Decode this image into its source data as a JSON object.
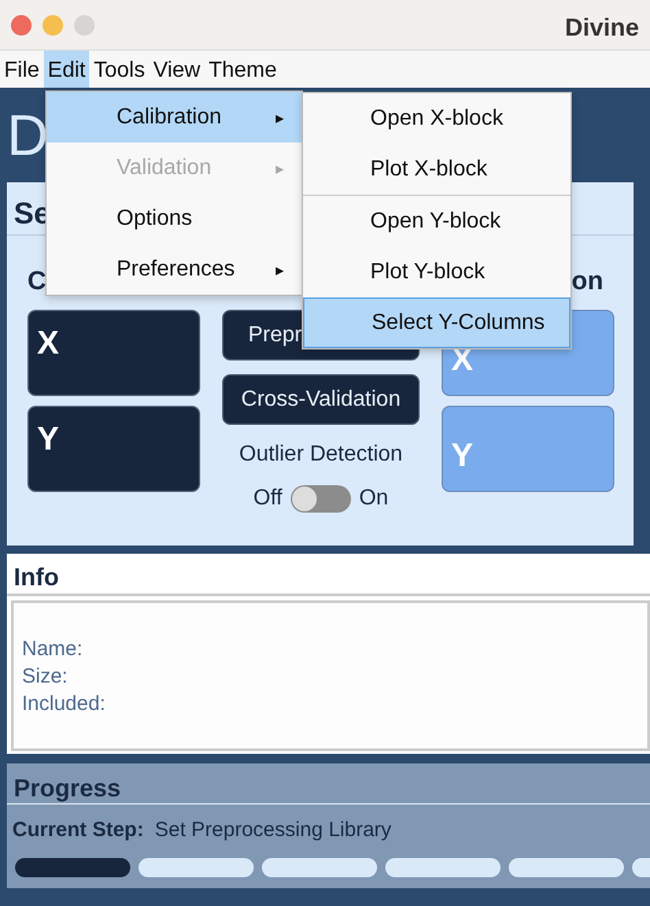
{
  "window": {
    "title": "Divine"
  },
  "menu_bar": [
    {
      "label": "File",
      "selected": false
    },
    {
      "label": "Edit",
      "selected": true
    },
    {
      "label": "Tools",
      "selected": false
    },
    {
      "label": "View",
      "selected": false
    },
    {
      "label": "Theme",
      "selected": false
    }
  ],
  "edit_menu": [
    {
      "label": "Calibration",
      "arrow": "▸",
      "selected": true,
      "disabled": false
    },
    {
      "label": "Validation",
      "arrow": "▸",
      "selected": false,
      "disabled": true
    },
    {
      "label": "Options",
      "selected": false,
      "disabled": false
    },
    {
      "label": "Preferences",
      "arrow": "▸",
      "selected": false,
      "disabled": false
    }
  ],
  "calibration_submenu": [
    {
      "label": "Open X-block",
      "selected": false,
      "separator_before": false
    },
    {
      "label": "Plot X-block",
      "selected": false,
      "separator_before": false
    },
    {
      "label": "Open Y-block",
      "selected": false,
      "separator_before": true
    },
    {
      "label": "Plot Y-block",
      "selected": false,
      "separator_before": false
    },
    {
      "label": "Select Y-Columns",
      "selected": true,
      "separator_before": false
    }
  ],
  "page_heading": "D",
  "setup_panel": {
    "title": "Se",
    "left_column": {
      "heading": "C",
      "blocks": [
        "X",
        "Y"
      ]
    },
    "middle_column": {
      "buttons": [
        "Prepr",
        "Cross-Validation"
      ],
      "outlier_detection": {
        "label": "Outlier Detection",
        "off_label": "Off",
        "on_label": "On",
        "on": false
      }
    },
    "right_column": {
      "heading": "on",
      "blocks": [
        "X",
        "Y"
      ]
    }
  },
  "info_panel": {
    "title": "Info",
    "fields": [
      "Name:",
      "Size:",
      "Included:"
    ]
  },
  "progress_panel": {
    "title": "Progress",
    "current_step_label": "Current Step:",
    "current_step": "Set Preprocessing Library",
    "steps": [
      {
        "complete": true
      },
      {
        "complete": false
      },
      {
        "complete": false
      },
      {
        "complete": false
      },
      {
        "complete": false
      },
      {
        "complete": false
      }
    ]
  }
}
